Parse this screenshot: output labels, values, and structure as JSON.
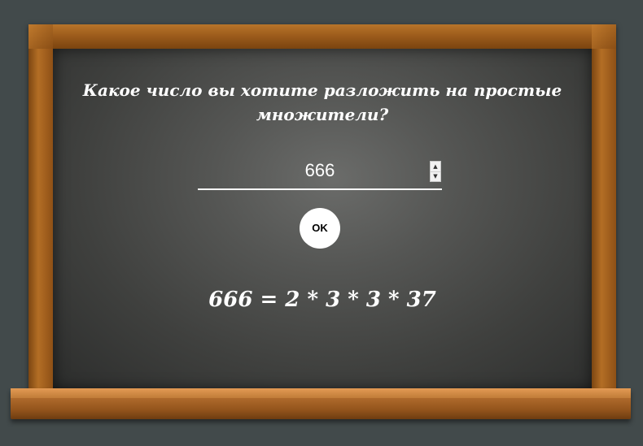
{
  "question": "Какое число вы хотите разложить на простые множители?",
  "input": {
    "value": "666"
  },
  "ok_button": {
    "label": "OK"
  },
  "result": "666 = 2 * 3 * 3 * 37",
  "spinner": {
    "up_icon": "triangle-up-icon",
    "down_icon": "triangle-down-icon"
  },
  "colors": {
    "background": "#424a4b",
    "board": "#555654",
    "wood": "#a8651f",
    "text": "#ffffff"
  }
}
